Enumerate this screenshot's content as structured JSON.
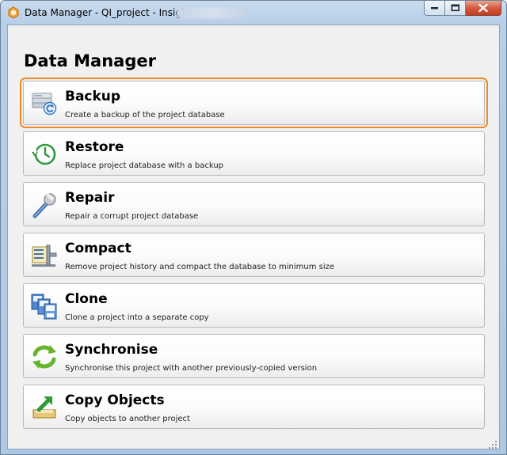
{
  "window": {
    "title": "Data Manager - QI_project - Insight",
    "icon": "insight-hexagon-icon",
    "controls": [
      "minimize-icon",
      "maximize-icon",
      "close-icon"
    ]
  },
  "page": {
    "heading": "Data Manager"
  },
  "accent_colors": {
    "focus_ring": "#ee8a24",
    "title_bar": "#b9cfe8",
    "close_button": "#c9462a"
  },
  "actions": [
    {
      "title": "Backup",
      "description": "Create a backup of the project database",
      "icon": "backup-database-icon",
      "focused": true
    },
    {
      "title": "Restore",
      "description": "Replace project database with a backup",
      "icon": "restore-clock-icon",
      "focused": false
    },
    {
      "title": "Repair",
      "description": "Repair a corrupt project database",
      "icon": "wrench-icon",
      "focused": false
    },
    {
      "title": "Compact",
      "description": "Remove project history and compact the database to minimum size",
      "icon": "compact-vise-icon",
      "focused": false
    },
    {
      "title": "Clone",
      "description": "Clone a project into a separate copy",
      "icon": "clone-documents-icon",
      "focused": false
    },
    {
      "title": "Synchronise",
      "description": "Synchronise this project with another previously-copied version",
      "icon": "sync-arrows-icon",
      "focused": false
    },
    {
      "title": "Copy Objects",
      "description": "Copy objects to another project",
      "icon": "copy-objects-icon",
      "focused": false
    }
  ]
}
